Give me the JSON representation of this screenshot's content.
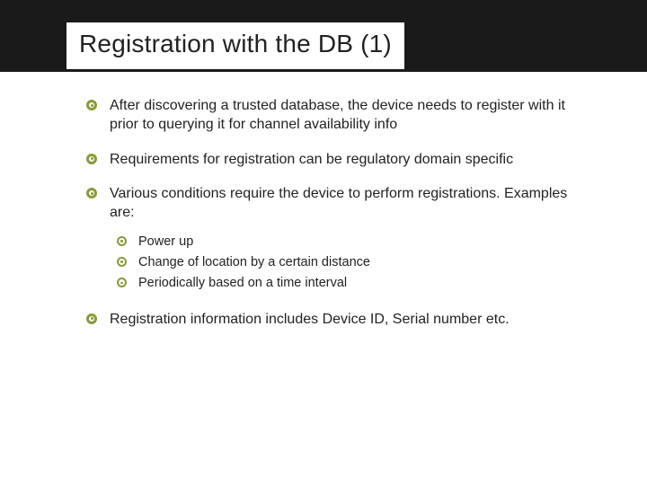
{
  "title": "Registration with the DB (1)",
  "bullets": {
    "b0": "After discovering a trusted database, the device needs to register with it prior to querying it for channel availability info",
    "b1": "Requirements for registration can be regulatory domain specific",
    "b2": "Various conditions require the device to perform registrations. Examples are:",
    "b2_sub": {
      "s0": "Power up",
      "s1": "Change of location by a certain distance",
      "s2": "Periodically based on a time interval"
    },
    "b3": "Registration information includes Device ID, Serial number etc."
  }
}
